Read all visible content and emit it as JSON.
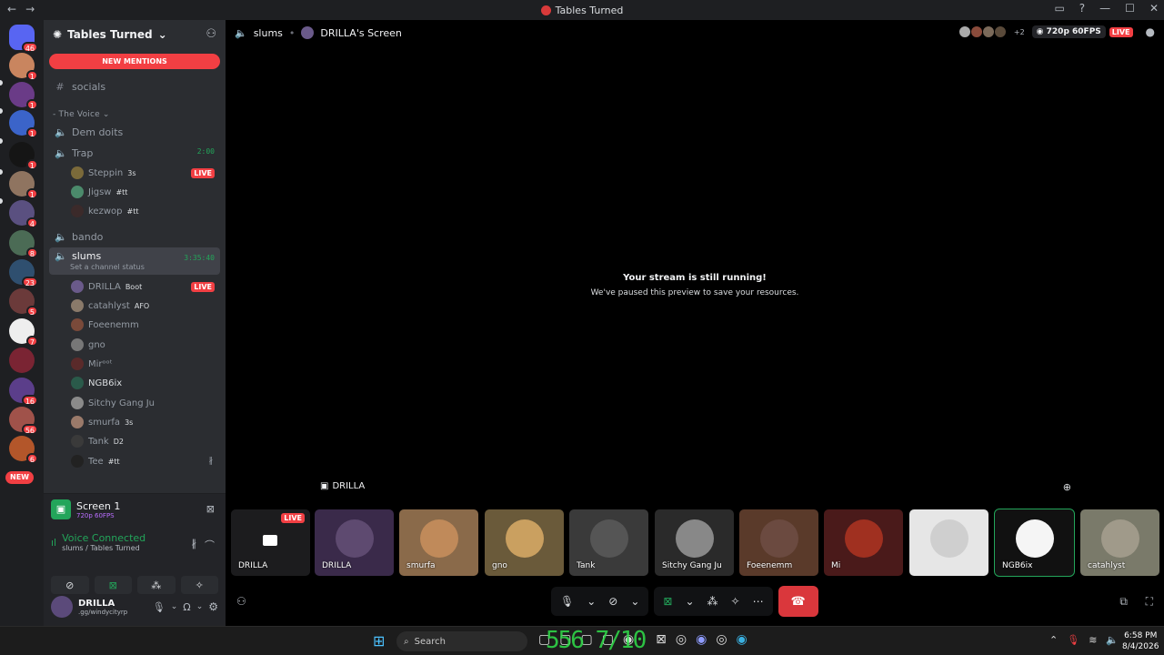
{
  "window": {
    "title": "Tables Turned",
    "nav_back": "←",
    "nav_fwd": "→"
  },
  "server": {
    "name": "Tables Turned",
    "new_mentions": "NEW MENTIONS"
  },
  "guild_badges": [
    "46",
    "1",
    "1",
    "1",
    "1",
    "1",
    "4",
    "8",
    "23",
    "5",
    "7",
    "16",
    "56",
    "6"
  ],
  "guild_new_pill": "NEW",
  "channels": {
    "socials": "socials",
    "voice_category": "- The Voice",
    "dem_doits": "Dem doits",
    "trap": {
      "name": "Trap",
      "time": "2:00"
    },
    "bando": "bando",
    "slums": {
      "name": "slums",
      "time": "3:35:40",
      "status": "Set a channel status"
    }
  },
  "trap_users": [
    {
      "name": "Steppin",
      "tag": "3s",
      "live": "LIVE"
    },
    {
      "name": "Jigsw",
      "tag": "#tt"
    },
    {
      "name": "kezwop",
      "tag": "#tt"
    }
  ],
  "slums_users": [
    {
      "name": "DRILLA",
      "tag": "Boot",
      "live": "LIVE"
    },
    {
      "name": "catahlyst",
      "tag": "AFO"
    },
    {
      "name": "Foeenemm",
      "tag": ""
    },
    {
      "name": "gno",
      "tag": ""
    },
    {
      "name": "Mirᵒᵒᵗ",
      "tag": ""
    },
    {
      "name": "NGB6ix",
      "tag": ""
    },
    {
      "name": "Sitchy Gang Ju",
      "tag": ""
    },
    {
      "name": "smurfa",
      "tag": "3s"
    },
    {
      "name": "Tank",
      "tag": "D2"
    },
    {
      "name": "Tee",
      "tag": "#tt"
    }
  ],
  "screen_panel": {
    "title": "Screen 1",
    "quality": "720p 60FPS",
    "voice_connected": "Voice Connected",
    "voice_location": "slums / Tables Turned"
  },
  "user_panel": {
    "name": "DRILLA",
    "status": ".gg/windycityrp"
  },
  "stream": {
    "channel": "slums",
    "screen_title": "DRILLA's Screen",
    "extra_count": "+2",
    "quality": "720p 60FPS",
    "live": "LIVE",
    "paused_title": "Your stream is still running!",
    "paused_sub": "We've paused this preview to save your resources.",
    "streamer_label": "DRILLA"
  },
  "tiles": [
    {
      "name": "DRILLA",
      "live": "LIVE"
    },
    {
      "name": "DRILLA"
    },
    {
      "name": "smurfa"
    },
    {
      "name": "gno"
    },
    {
      "name": "Tank"
    },
    {
      "name": "Sitchy Gang Ju"
    },
    {
      "name": "Foeenemm"
    },
    {
      "name": "Mi"
    },
    {
      "name": ""
    },
    {
      "name": "NGB6ix"
    },
    {
      "name": "catahlyst"
    }
  ],
  "taskbar": {
    "search": "Search",
    "overlay": "556 7/10",
    "time": "6:58 PM",
    "date": "8/4/2026"
  },
  "colors": {
    "live": "#f23f43",
    "green": "#23a55a",
    "hangup": "#da373c",
    "sidebar": "#2b2d31"
  }
}
